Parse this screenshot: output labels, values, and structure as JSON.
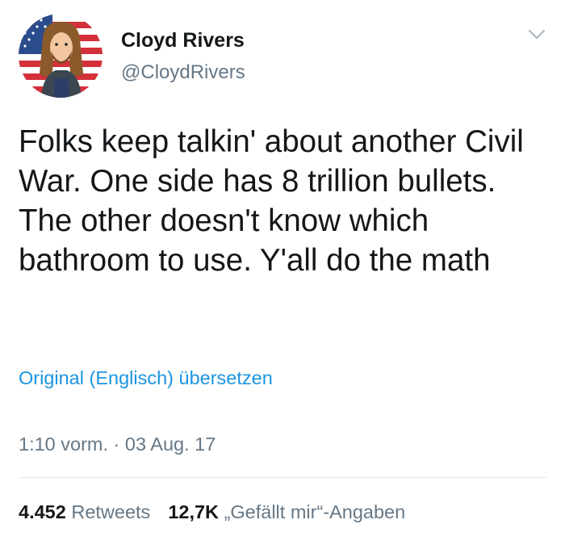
{
  "user": {
    "display_name": "Cloyd Rivers",
    "handle": "@CloydRivers",
    "avatar_icon": "avatar-caricature-flag-icon"
  },
  "menu_icon": "chevron-down-icon",
  "tweet": {
    "text": "Folks keep talkin' about another Civil War. One side has 8 trillion bullets. The other doesn't know which bathroom to use. Y'all do the math",
    "translate_label": "Original (Englisch) übersetzen",
    "timestamp": "1:10 vorm. · 03 Aug. 17"
  },
  "stats": {
    "retweets_count": "4.452",
    "retweets_label": "Retweets",
    "likes_count": "12,7K",
    "likes_label": "„Gefällt mir“-Angaben"
  },
  "colors": {
    "text_primary": "#14171a",
    "text_secondary": "#657786",
    "link": "#1b95e0",
    "divider": "#e1e8ed"
  }
}
